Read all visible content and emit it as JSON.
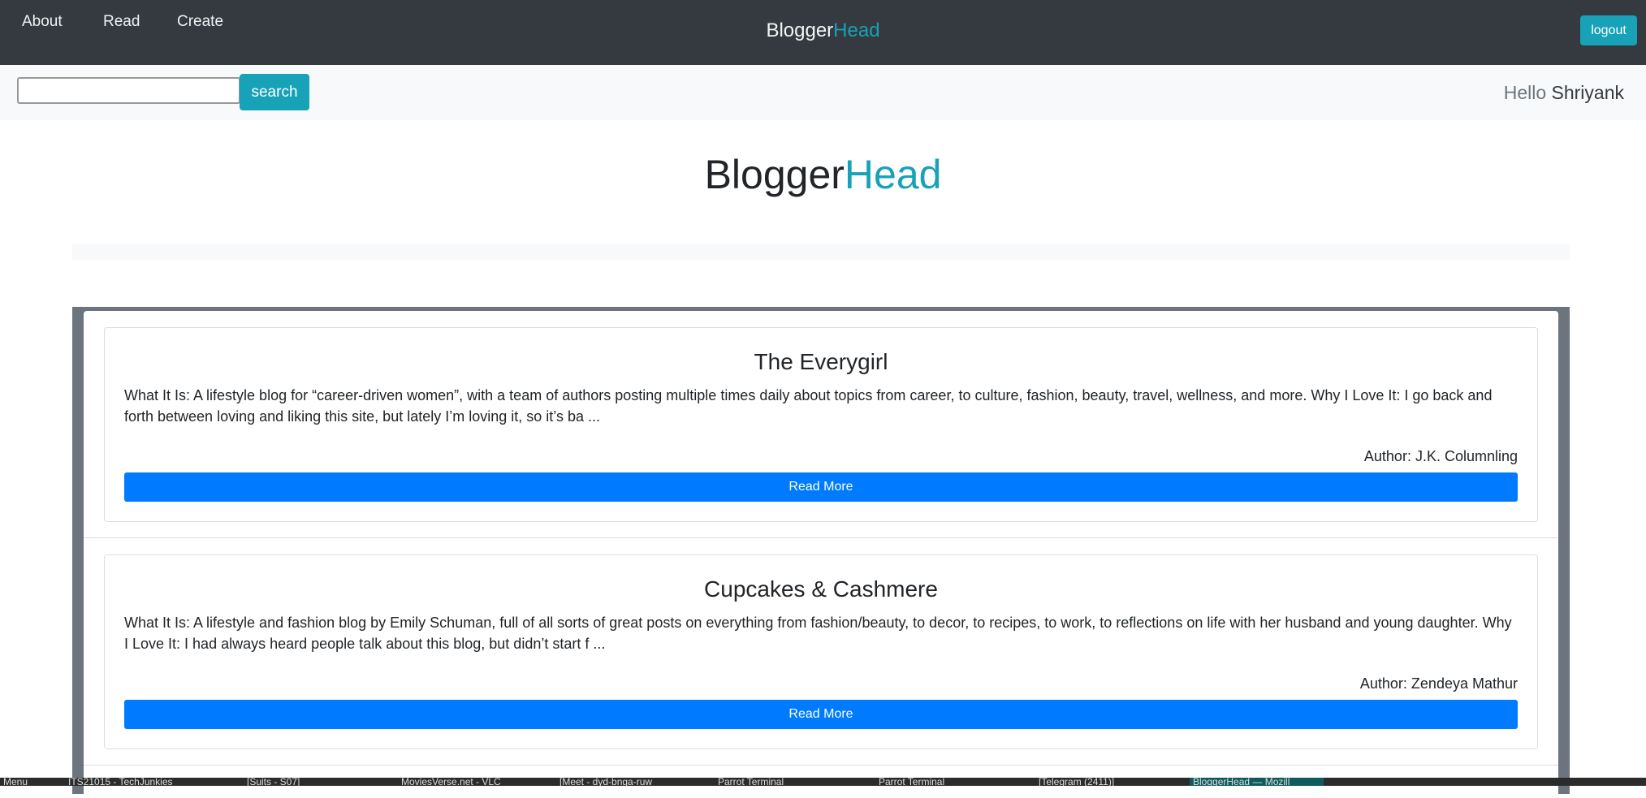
{
  "nav": {
    "links": [
      "About",
      "Read",
      "Create"
    ],
    "brand_a": "Blogger",
    "brand_b": "Head",
    "logout": "logout"
  },
  "subbar": {
    "search_value": "",
    "search_label": "search",
    "hello": "Hello",
    "user": "Shriyank"
  },
  "title": {
    "a": "Blogger",
    "b": "Head"
  },
  "posts": [
    {
      "title": "The Everygirl",
      "excerpt": "What It Is: A lifestyle blog for “career-driven women”, with a team of authors posting multiple times daily about topics from career, to culture, fashion, beauty, travel, wellness, and more. Why I Love It: I go back and forth between loving and liking this site, but lately I’m loving it, so it’s ba ...",
      "author": "Author: J.K. Columnling",
      "button": "Read More"
    },
    {
      "title": "Cupcakes & Cashmere",
      "excerpt": "What It Is: A lifestyle and fashion blog by Emily Schuman, full of all sorts of great posts on everything from fashion/beauty, to decor, to recipes, to work, to reflections on life with her husband and young daughter. Why I Love It: I had always heard people talk about this blog, but didn’t start f ...",
      "author": "Author: Zendeya Mathur",
      "button": "Read More"
    }
  ],
  "taskbar": [
    "Menu",
    "ITS21015 - TechJunkies",
    "[Suits - S07]",
    "MoviesVerse.net - VLC",
    "[Meet - dyd-bnga-ruw",
    "Parrot Terminal",
    "Parrot Terminal",
    "[Telegram (2411)]",
    "BloggerHead — Mozill"
  ],
  "colors": {
    "navbar": "#343a40",
    "accent": "#17a2b8",
    "primary": "#007bff",
    "container": "#6c757d"
  }
}
